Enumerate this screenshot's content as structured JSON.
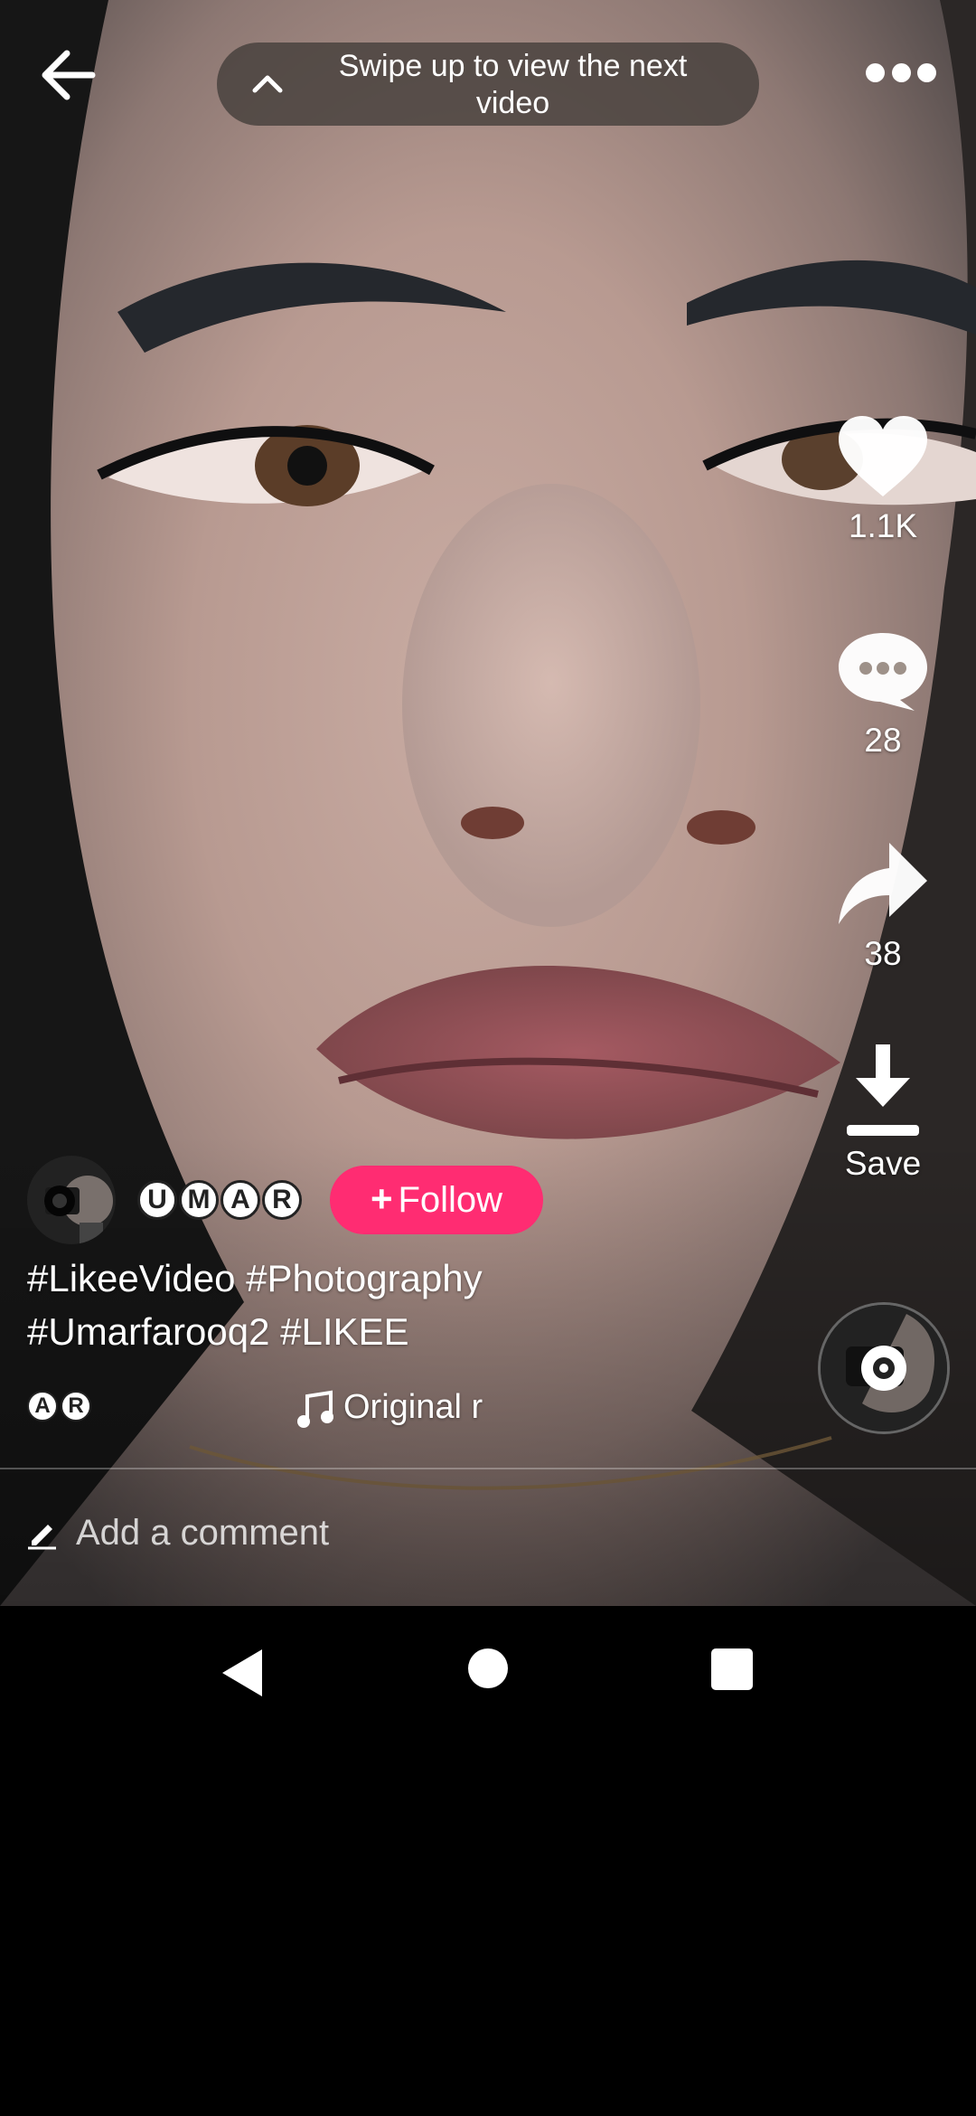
{
  "top_bar": {
    "hint_text": "Swipe up to view the next video"
  },
  "actions": {
    "like_count": "1.1K",
    "comment_count": "28",
    "share_count": "38",
    "save_label": "Save"
  },
  "creator": {
    "name_badges": [
      "U",
      "M",
      "A",
      "R"
    ],
    "follow_label": "Follow"
  },
  "caption": {
    "line1": "#LikeeVideo #Photography",
    "line2": "#Umarfarooq2 #LIKEE"
  },
  "music": {
    "badges": [
      "A",
      "R"
    ],
    "title": "Original r"
  },
  "comment": {
    "placeholder": "Add a comment"
  },
  "colors": {
    "follow_button": "#ff2c72",
    "nav_background": "#000000"
  }
}
